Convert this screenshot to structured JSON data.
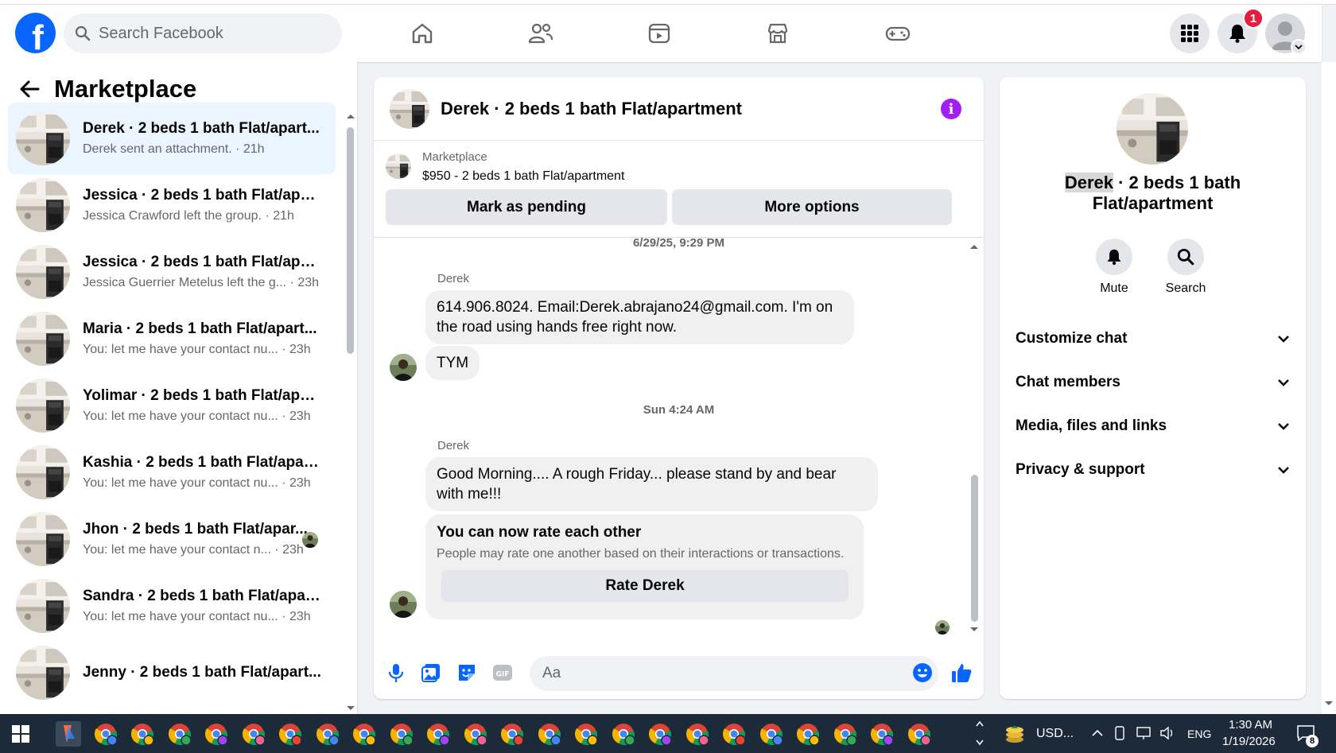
{
  "colors": {
    "brand": "#0866ff",
    "badge": "#e41e3f",
    "active_row": "#ebf5ff",
    "bubble": "#f0f0f0",
    "info": "#a020f0",
    "like": "#0866ff"
  },
  "topbar": {
    "logo_letter": "f",
    "search_placeholder": "Search Facebook",
    "nav_icons": [
      "home-icon",
      "friends-icon",
      "video-icon",
      "marketplace-icon",
      "gaming-icon"
    ],
    "notification_count": "1"
  },
  "left": {
    "title": "Marketplace",
    "conversations": [
      {
        "title": "Derek · 2 beds 1 bath Flat/apart...",
        "subtitle": "Derek sent an attachment.",
        "time": "21h"
      },
      {
        "title": "Jessica · 2 beds 1 bath Flat/apart...",
        "subtitle": "Jessica Crawford left the group.",
        "time": "21h"
      },
      {
        "title": "Jessica · 2 beds 1 bath Flat/apart...",
        "subtitle": "Jessica Guerrier Metelus left the g...",
        "time": "23h"
      },
      {
        "title": "Maria · 2 beds 1 bath Flat/apart...",
        "subtitle": "You: let me have your contact nu...",
        "time": "23h"
      },
      {
        "title": "Yolimar · 2 beds 1 bath Flat/apar...",
        "subtitle": "You: let me have your contact nu...",
        "time": "23h"
      },
      {
        "title": "Kashia · 2 beds 1 bath Flat/apart...",
        "subtitle": "You: let me have your contact nu...",
        "time": "23h"
      },
      {
        "title": "Jhon · 2 beds 1 bath Flat/apar...",
        "subtitle": "You: let me have your contact n...",
        "time": "23h"
      },
      {
        "title": "Sandra · 2 beds 1 bath Flat/apart...",
        "subtitle": "You: let me have your contact nu...",
        "time": "23h"
      },
      {
        "title": "Jenny · 2 beds 1 bath Flat/apart...",
        "subtitle": "",
        "time": ""
      }
    ]
  },
  "chat": {
    "title": "Derek · 2 beds 1 bath Flat/apartment",
    "marketplace_label": "Marketplace",
    "listing": "$950 - 2 beds 1 bath Flat/apartment",
    "mark_pending": "Mark as pending",
    "more_options": "More options",
    "timestamp1": "6/29/25, 9:29 PM",
    "sender1": "Derek",
    "msg1": "614.906.8024. Email:Derek.abrajano24@gmail.com. I'm on the road using hands free right now.",
    "msg2": "TYM",
    "timestamp2": "Sun 4:24 AM",
    "sender2": "Derek",
    "msg3": "Good Morning.... A rough Friday... please stand by and bear with me!!!",
    "rate_title": "You can now rate each other",
    "rate_sub": "People may rate one another based on their interactions or transactions.",
    "rate_button": "Rate Derek",
    "composer_placeholder": "Aa"
  },
  "right": {
    "name_highlight": "Derek",
    "name_rest": " · 2 beds 1 bath Flat/apartment",
    "mute": "Mute",
    "search": "Search",
    "sections": [
      "Customize chat",
      "Chat members",
      "Media, files and links",
      "Privacy & support"
    ]
  },
  "taskbar": {
    "ticker": "USD...",
    "lang": "ENG",
    "time": "1:30 AM",
    "date": "1/19/2026",
    "notif": "8"
  }
}
